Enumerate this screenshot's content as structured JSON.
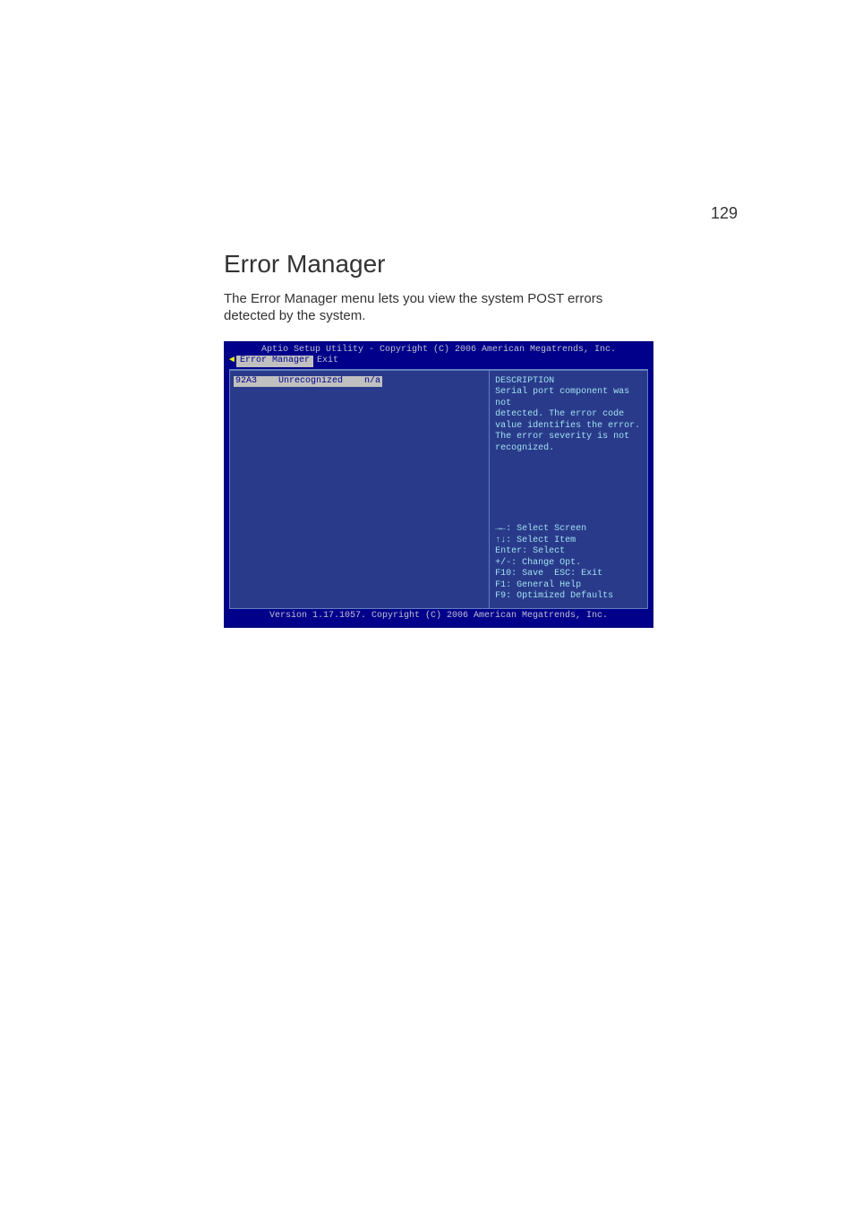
{
  "page_number": "129",
  "heading": "Error Manager",
  "body_text": "The Error Manager menu lets you view the system POST errors detected by the system.",
  "bios": {
    "title": "Aptio Setup Utility - Copyright (C) 2006 American Megatrends, Inc.",
    "tab_arrow": "◄",
    "tab_active": "Error Manager",
    "tab_other": "Exit",
    "row": {
      "code": "92A3",
      "status": "Unrecognized",
      "value": "n/a"
    },
    "desc": {
      "title": "DESCRIPTION",
      "l1": "Serial port component was not",
      "l2": "detected.      The error code",
      "l3": "value identifies the error.",
      "l4": "The error severity is not",
      "l5": "recognized."
    },
    "nav": {
      "l1": "→←: Select Screen",
      "l2": "↑↓: Select Item",
      "l3": "Enter: Select",
      "l4": "+/-: Change Opt.",
      "l5": "F10: Save  ESC: Exit",
      "l6": "F1: General Help",
      "l7": "F9: Optimized Defaults"
    },
    "footer": "Version 1.17.1057. Copyright (C) 2006 American Megatrends, Inc."
  }
}
